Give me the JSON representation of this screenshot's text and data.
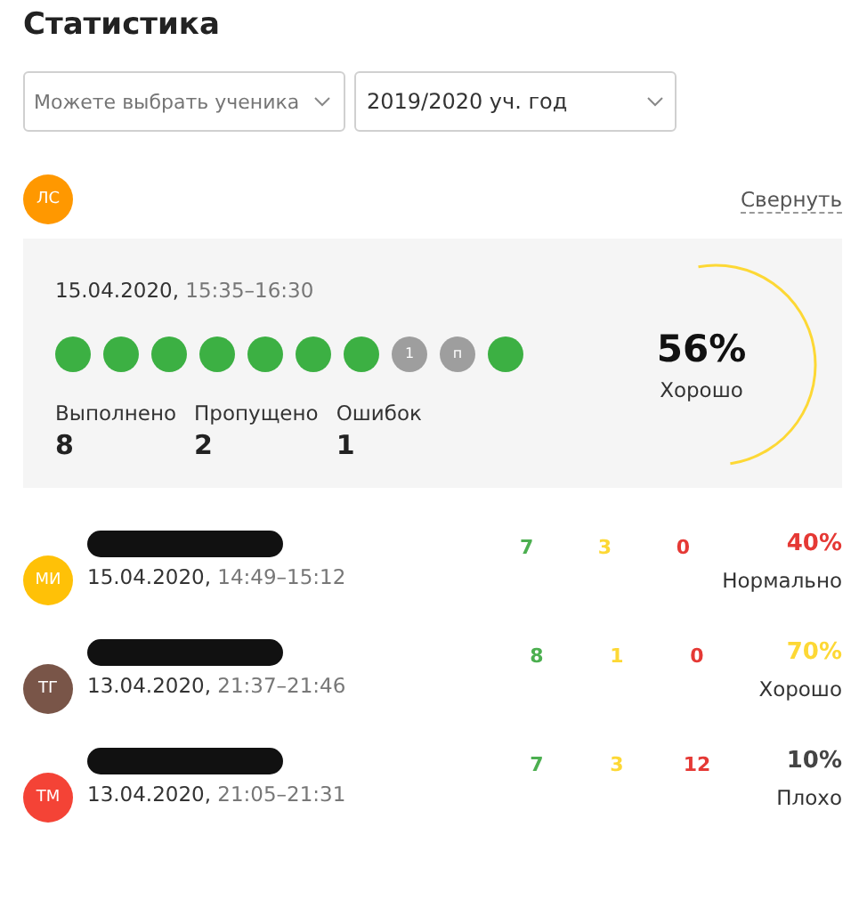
{
  "title": "Статистика",
  "filters": [
    {
      "placeholder": "Можете выбрать ученика"
    },
    {
      "value": "2019/2020 уч. год"
    }
  ],
  "current": {
    "avatar": {
      "initials": "ЛС",
      "color": "#ff9800"
    },
    "collapse_link": "Свернуть",
    "date": "15.04.2020,",
    "time": "15:35–16:30",
    "tasks": [
      {
        "kind": "done"
      },
      {
        "kind": "done"
      },
      {
        "kind": "done"
      },
      {
        "kind": "done"
      },
      {
        "kind": "done"
      },
      {
        "kind": "done"
      },
      {
        "kind": "done"
      },
      {
        "kind": "marked",
        "label": "1"
      },
      {
        "kind": "marked",
        "label": "п"
      },
      {
        "kind": "done"
      }
    ],
    "stats": [
      {
        "label": "Выполнено",
        "value": "8"
      },
      {
        "label": "Пропущено",
        "value": "2"
      },
      {
        "label": "Ошибок",
        "value": "1"
      }
    ],
    "score": {
      "percent": "56%",
      "grade": "Хорошо",
      "level": 0.56
    }
  },
  "rows": [
    {
      "avatar": {
        "initials": "МИ",
        "color": "#ffc107"
      },
      "date": "15.04.2020,",
      "time": "14:49–15:12",
      "done": "7",
      "skipped": "3",
      "errors": "0",
      "percent": "40%",
      "color": "#e53935",
      "grade": "Нормально"
    },
    {
      "avatar": {
        "initials": "ТГ",
        "color": "#795548"
      },
      "date": "13.04.2020,",
      "time": "21:37–21:46",
      "done": "8",
      "skipped": "1",
      "errors": "0",
      "percent": "70%",
      "color": "#fdd835",
      "grade": "Хорошо"
    },
    {
      "avatar": {
        "initials": "ТМ",
        "color": "#f44336"
      },
      "date": "13.04.2020,",
      "time": "21:05–21:31",
      "done": "7",
      "skipped": "3",
      "errors": "12",
      "percent": "10%",
      "color": "#444444",
      "grade": "Плохо"
    }
  ]
}
